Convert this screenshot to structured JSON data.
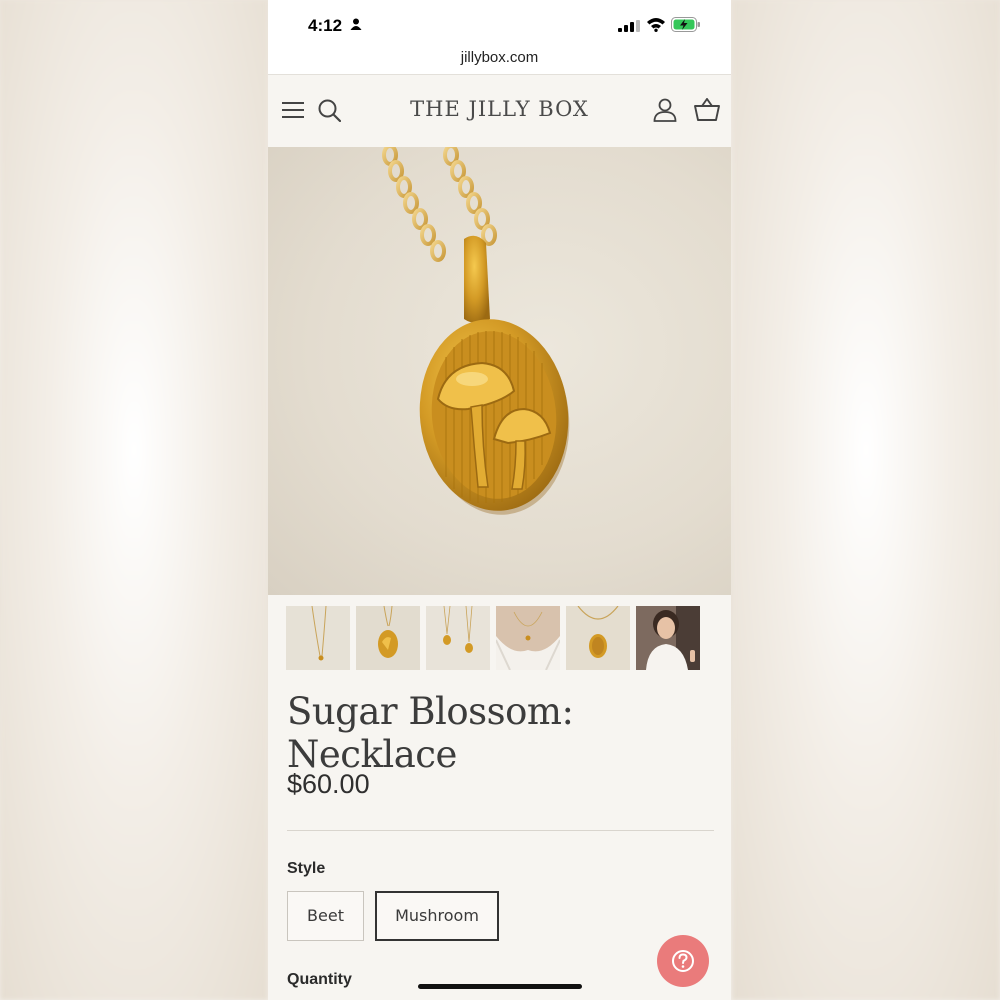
{
  "status_bar": {
    "time": "4:12",
    "icons": [
      "person-icon",
      "signal-icon",
      "wifi-icon",
      "battery-charging-icon"
    ]
  },
  "browser": {
    "url": "jillybox.com"
  },
  "header": {
    "brand": "THE JILLY BOX",
    "icons": [
      "menu-icon",
      "search-icon",
      "account-icon",
      "cart-icon"
    ]
  },
  "gallery": {
    "thumbnail_count": 6,
    "selected_index": 1,
    "thumbnails": [
      "thumb-long-chain",
      "thumb-pendant-closeup",
      "thumb-two-pendants",
      "thumb-worn-on-model",
      "thumb-pendant-on-chain",
      "thumb-model-portrait"
    ]
  },
  "product": {
    "title": "Sugar Blossom: Necklace",
    "price": "$60.00"
  },
  "options": {
    "style_label": "Style",
    "styles": [
      "Beet",
      "Mushroom"
    ],
    "selected_style": "Mushroom",
    "quantity_label": "Quantity"
  },
  "colors": {
    "accent_help": "#ea7b7b",
    "text_dark": "#3c3c3c",
    "gold": "#d19a2a"
  }
}
